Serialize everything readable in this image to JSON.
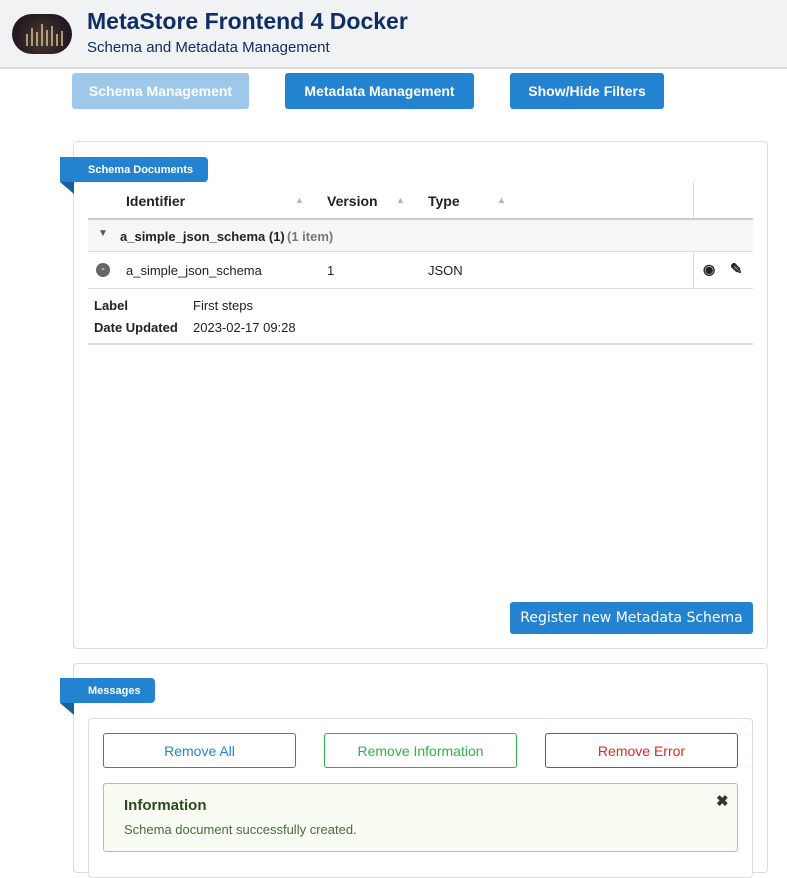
{
  "header": {
    "title": "MetaStore Frontend 4 Docker",
    "subtitle": "Schema and Metadata Management"
  },
  "nav": {
    "schema_management": "Schema Management",
    "metadata_management": "Metadata Management",
    "show_hide_filters": "Show/Hide Filters"
  },
  "schema_panel": {
    "title": "Schema Documents",
    "columns": [
      "Identifier",
      "Version",
      "Type"
    ],
    "group": {
      "label": "a_simple_json_schema (1)",
      "count": "(1 item)"
    },
    "row": {
      "identifier": "a_simple_json_schema",
      "version": "1",
      "type": "JSON",
      "actions": [
        "eye-icon",
        "edit-icon"
      ]
    },
    "details": [
      {
        "key": "Label",
        "value": "First steps"
      },
      {
        "key": "Date Updated",
        "value": "2023-02-17 09:28"
      }
    ],
    "register_button": "Register new Metadata Schema"
  },
  "messages_panel": {
    "title": "Messages",
    "remove_all": "Remove All",
    "remove_information": "Remove Information",
    "remove_error": "Remove Error",
    "message": {
      "title": "Information",
      "text": "Schema document successfully created."
    }
  },
  "colors": {
    "primary": "#2383d1",
    "info": "#2bb34a",
    "error": "#e02828",
    "title": "#0f2d66"
  }
}
